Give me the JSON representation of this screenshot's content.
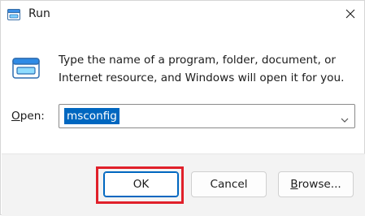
{
  "window": {
    "title": "Run",
    "title_icon": "run-icon",
    "close_icon": "close-icon"
  },
  "dialog": {
    "icon": "run-icon",
    "description_line1": "Type the name of a program, folder, document, or",
    "description_line2": "Internet resource, and Windows will open it for you."
  },
  "open": {
    "label_mnemonic": "O",
    "label_rest": "pen:",
    "value": "msconfig",
    "dropdown_icon": "chevron-down-icon"
  },
  "buttons": {
    "ok": "OK",
    "cancel": "Cancel",
    "browse_mnemonic": "B",
    "browse_rest": "rowse..."
  },
  "colors": {
    "accent": "#0067c0",
    "highlight_box": "#e0202a",
    "footer_bg": "#f3f3f3"
  }
}
